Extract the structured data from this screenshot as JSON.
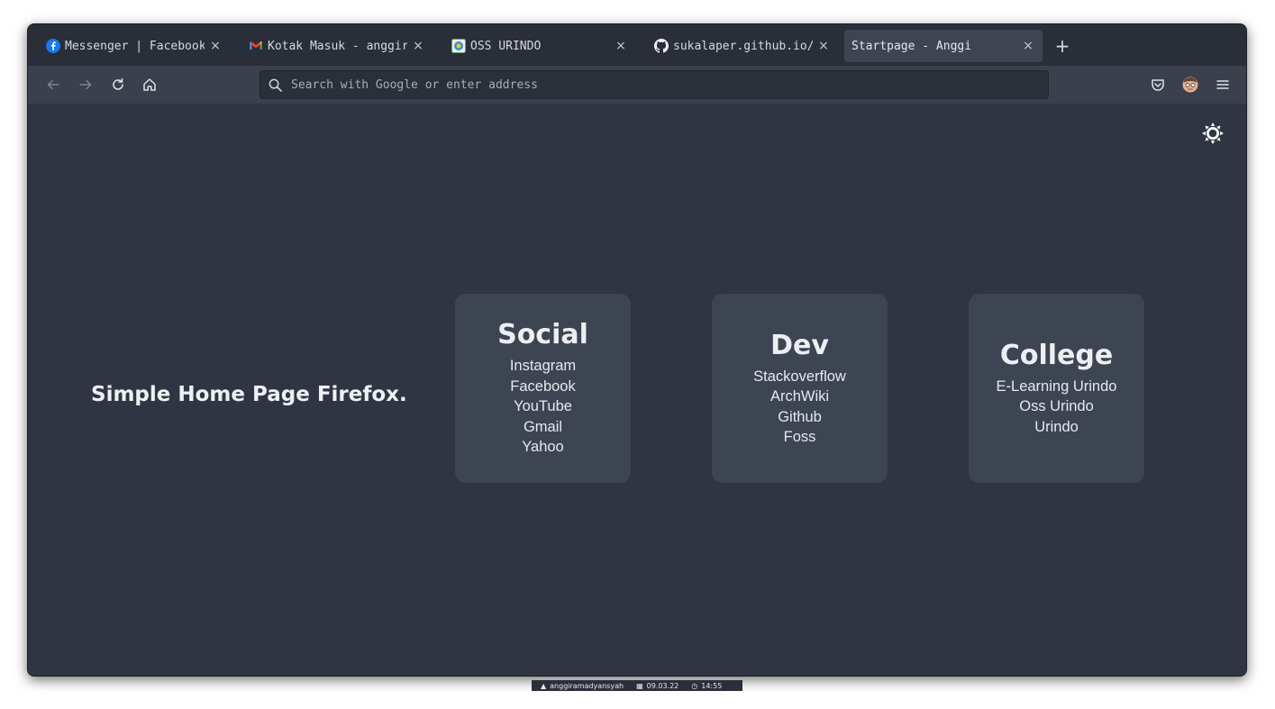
{
  "browser": {
    "tabs": [
      {
        "title": "Messenger | Facebook",
        "favicon": "facebook-icon",
        "active": false
      },
      {
        "title": "Kotak Masuk - anggirrr",
        "favicon": "gmail-icon",
        "active": false
      },
      {
        "title": "OSS URINDO",
        "favicon": "urindo-icon",
        "active": false
      },
      {
        "title": "sukalaper.github.io/in",
        "favicon": "github-icon",
        "active": false
      },
      {
        "title": "Startpage - Anggi",
        "favicon": "",
        "active": true
      }
    ],
    "newtab_label": "+",
    "close_glyph": "×",
    "urlbar": {
      "placeholder": "Search with Google or enter address",
      "value": ""
    },
    "colors": {
      "window_bg": "#2f3542",
      "tabbar_bg": "#2a2e38",
      "navbar_bg": "#3a404c",
      "card_bg": "#3d4452"
    }
  },
  "page": {
    "headline": "Simple Home Page Firefox.",
    "theme_toggle_icon": "sun-icon",
    "cards": [
      {
        "title": "Social",
        "links": [
          "Instagram",
          "Facebook",
          "YouTube",
          "Gmail",
          "Yahoo"
        ]
      },
      {
        "title": "Dev",
        "links": [
          "Stackoverflow",
          "ArchWiki",
          "Github",
          "Foss"
        ]
      },
      {
        "title": "College",
        "links": [
          "E-Learning Urindo",
          "Oss Urindo",
          "Urindo"
        ]
      }
    ]
  },
  "taskbar": {
    "user": "anggiramadyansyah",
    "date": "09.03.22",
    "time": "14:55"
  }
}
